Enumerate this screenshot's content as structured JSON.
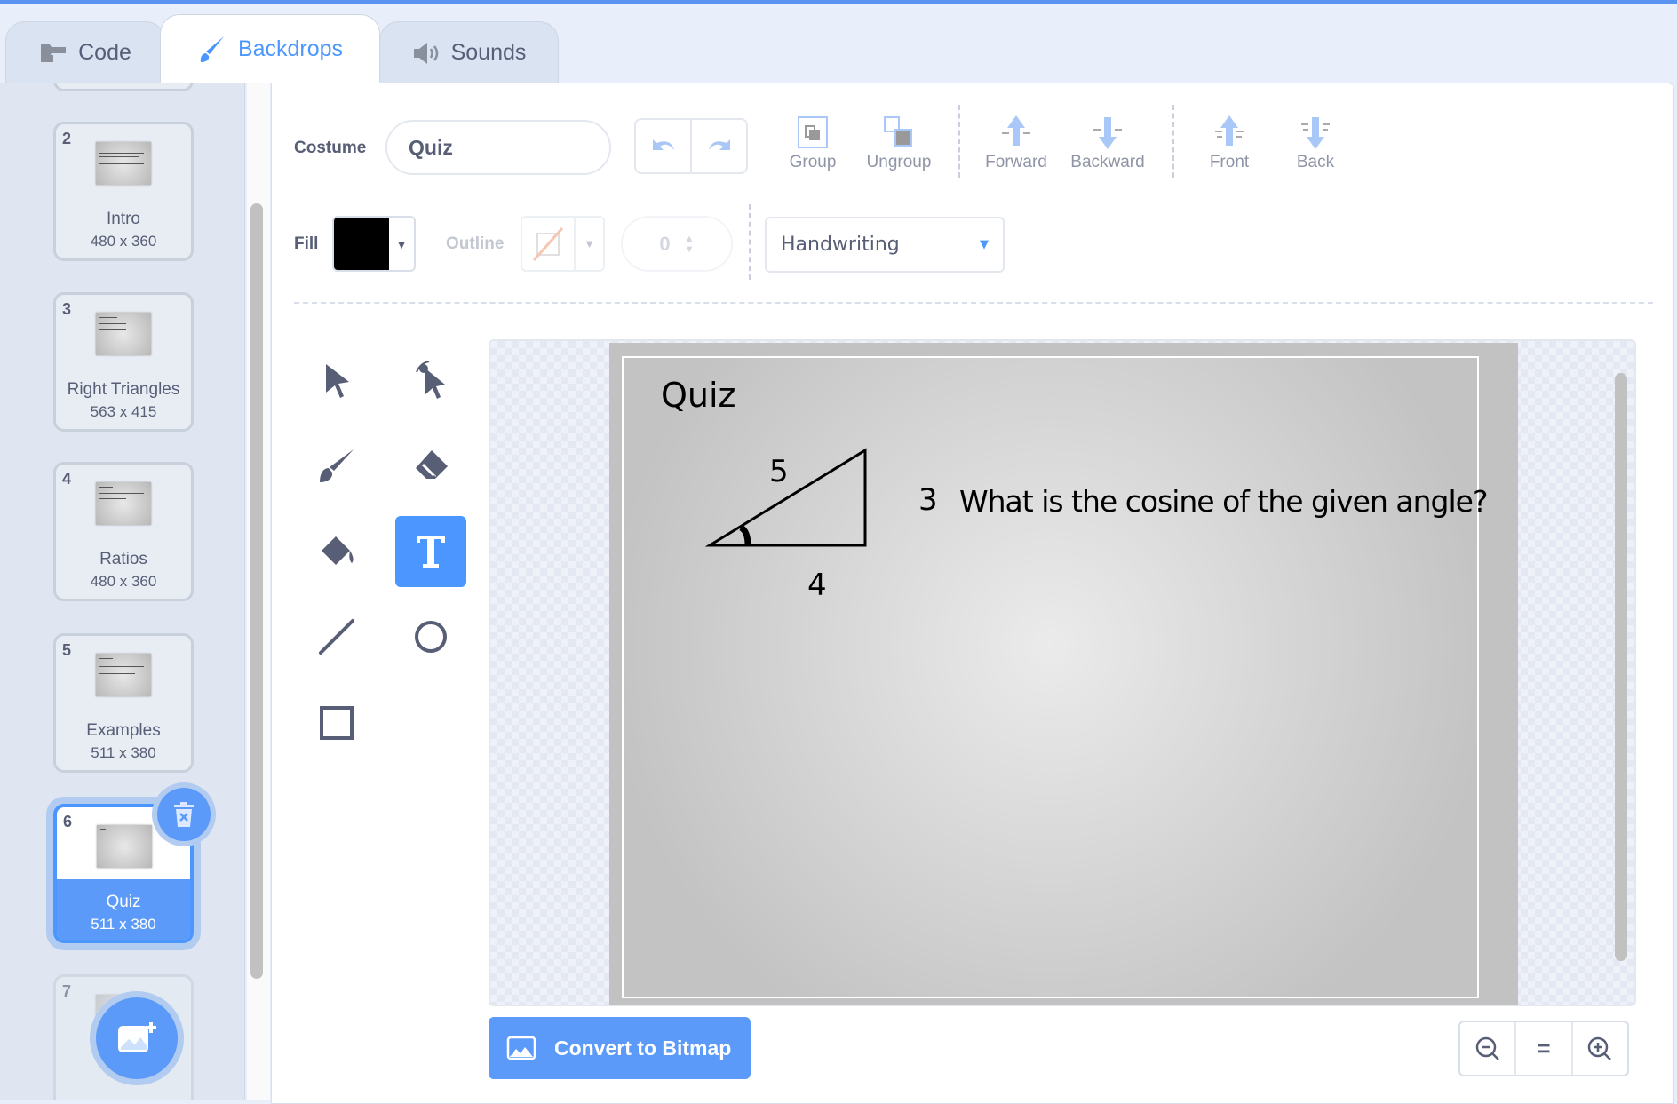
{
  "tabs": [
    {
      "label": "Code",
      "icon": "code-blocks-icon"
    },
    {
      "label": "Backdrops",
      "icon": "paintbrush-icon",
      "active": true
    },
    {
      "label": "Sounds",
      "icon": "speaker-icon"
    }
  ],
  "backdrops": [
    {
      "num": "2",
      "name": "Intro",
      "size": "480 x 360"
    },
    {
      "num": "3",
      "name": "Right Triangles",
      "size": "563 x 415"
    },
    {
      "num": "4",
      "name": "Ratios",
      "size": "480 x 360"
    },
    {
      "num": "5",
      "name": "Examples",
      "size": "511 x 380"
    },
    {
      "num": "6",
      "name": "Quiz",
      "size": "511 x 380",
      "selected": true
    },
    {
      "num": "7"
    }
  ],
  "toolbar": {
    "costume_label": "Costume",
    "costume_name": "Quiz",
    "group": "Group",
    "ungroup": "Ungroup",
    "forward": "Forward",
    "backward": "Backward",
    "front": "Front",
    "back": "Back",
    "fill_label": "Fill",
    "fill_color": "#000000",
    "outline_label": "Outline",
    "outline_width": "0",
    "font": "Handwriting"
  },
  "tools": [
    "select",
    "reshape",
    "brush",
    "eraser",
    "fill",
    "text",
    "line",
    "circle",
    "rectangle"
  ],
  "active_tool": "text",
  "stage": {
    "title": "Quiz",
    "side_hyp": "5",
    "side_opp": "3",
    "side_adj": "4",
    "question": "What is the cosine of the given angle?"
  },
  "bottom": {
    "convert": "Convert to Bitmap",
    "zoom_reset": "="
  },
  "colors": {
    "accent": "#4c97ff",
    "sidebar": "#dfe6f1"
  }
}
